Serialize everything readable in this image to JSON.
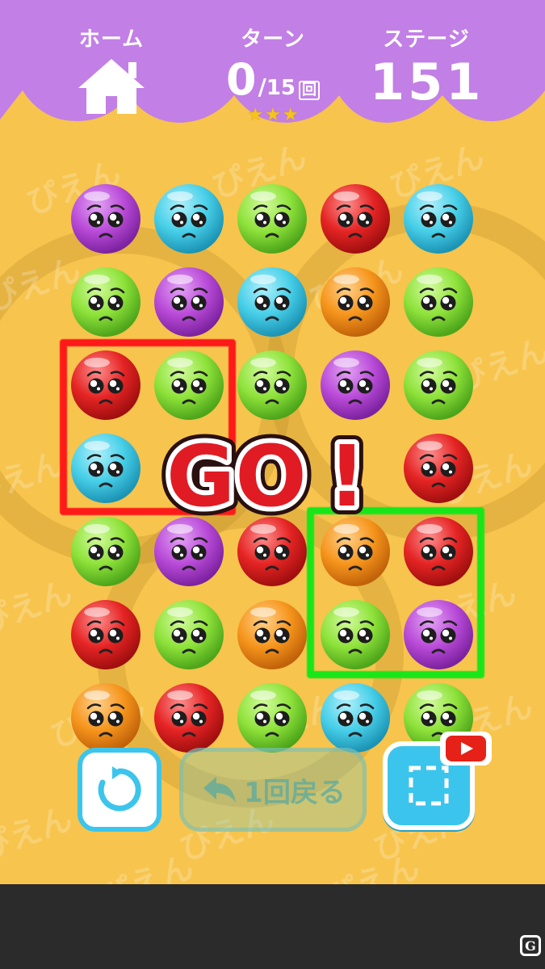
{
  "header": {
    "home_label": "ホーム",
    "turn_label": "ターン",
    "turn_current": "0",
    "turn_max": "15",
    "turn_unit": "回",
    "stars": 3,
    "stage_label": "ステージ",
    "stage_number": "151"
  },
  "board": {
    "rows": [
      [
        "purple",
        "cyan",
        "green",
        "red",
        "cyan"
      ],
      [
        "green",
        "purple",
        "cyan",
        "orange",
        "green"
      ],
      [
        "red",
        "green",
        "green",
        "purple",
        "green"
      ],
      [
        "cyan",
        "",
        "",
        "",
        "red"
      ],
      [
        "green",
        "purple",
        "red",
        "orange",
        "red"
      ],
      [
        "red",
        "green",
        "orange",
        "green",
        "purple"
      ],
      [
        "orange",
        "red",
        "green",
        "cyan",
        "green"
      ]
    ],
    "highlights": [
      {
        "color": "#ff1a1a",
        "label": "red-selection"
      },
      {
        "color": "#19e619",
        "label": "green-selection"
      }
    ]
  },
  "banner": {
    "text_left": "GO",
    "text_bang": "!"
  },
  "buttons": {
    "retry_icon": "refresh-icon",
    "undo_label": "1回戻る",
    "undo_icon": "undo-arrow-icon",
    "skip_icon": "dashed-square-icon",
    "video_icon": "youtube-play-icon"
  },
  "background_word": "ぴえん",
  "watermark": "G",
  "colors": {
    "header_purple": "#c27fe6",
    "background_yellow": "#f7c44d",
    "button_cyan": "#3cc5ec",
    "go_red": "#e01b24"
  }
}
